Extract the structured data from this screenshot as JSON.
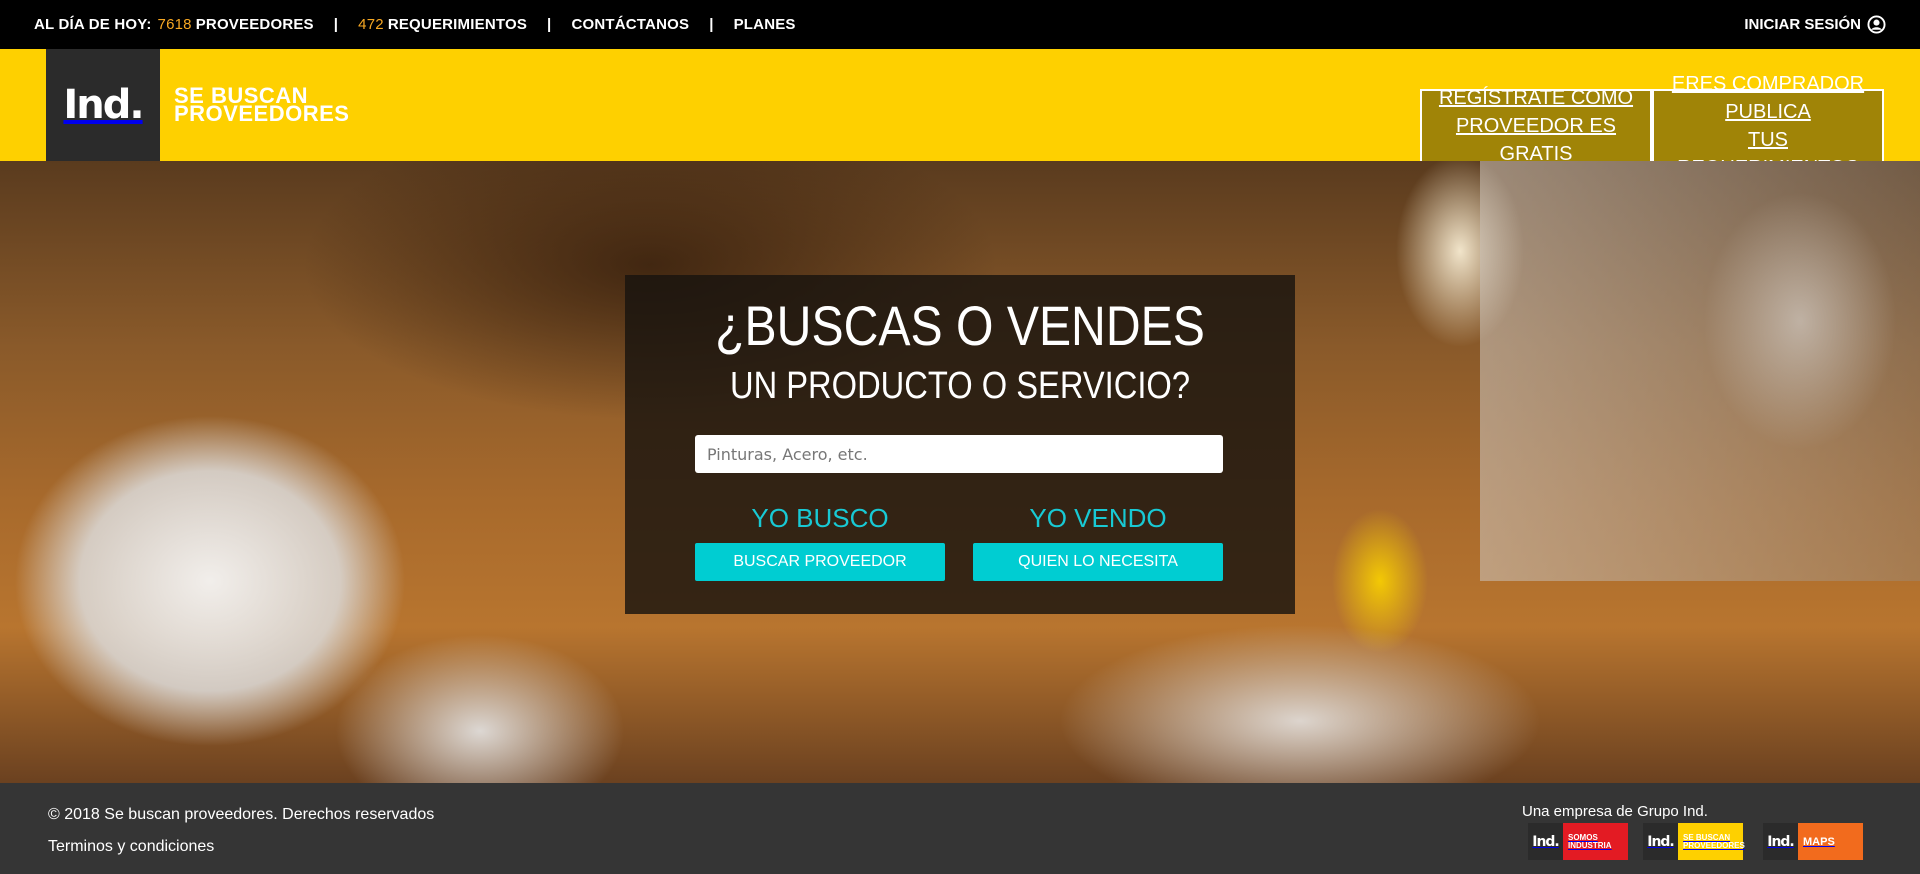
{
  "topbar": {
    "today_label": "AL DÍA DE HOY:",
    "providers_count": "7618",
    "providers_label": "PROVEEDORES",
    "sep1": "|",
    "requirements_count": "472",
    "requirements_label": "REQUERIMIENTOS",
    "sep2": "|",
    "contact_label": "CONTÁCTANOS",
    "sep3": "|",
    "plans_label": "PLANES",
    "login_label": "INICIAR SESIÓN",
    "login_icon": "user-circle-icon"
  },
  "header": {
    "logo_text": "Ind.",
    "brand_line1": "SE BUSCAN",
    "brand_line2": "PROVEEDORES",
    "register_btn_line1": "REGÍSTRATE COMO",
    "register_btn_line2": "PROVEEDOR ES GRATIS",
    "buyer_btn_line1": "ERES COMPRADOR PUBLICA",
    "buyer_btn_line2": "TUS REQUERIMIENTOS"
  },
  "search_panel": {
    "title": "¿BUSCAS O VENDES",
    "subtitle": "UN PRODUCTO O SERVICIO?",
    "search_placeholder": "Pinturas, Acero, etc.",
    "search_value": "",
    "buy_label": "YO BUSCO",
    "buy_button": "BUSCAR PROVEEDOR",
    "sell_label": "YO VENDO",
    "sell_button": "QUIEN LO NECESITA"
  },
  "footer": {
    "copyright": "© 2018 Se buscan proveedores. Derechos reservados",
    "terms": "Terminos y condiciones",
    "group_text": "Una empresa de Grupo Ind.",
    "logos": [
      {
        "mark": "Ind.",
        "line1": "SOMOS",
        "line2": "INDUSTRIA"
      },
      {
        "mark": "Ind.",
        "line1": "SE BUSCAN",
        "line2": "PROVEEDORES"
      },
      {
        "mark": "Ind.",
        "line1": "MAPS",
        "line2": ""
      }
    ]
  },
  "colors": {
    "accent_yellow": "#fed000",
    "header_button": "#a08407",
    "cyan": "#00cdd2",
    "counter_orange": "#f7a823",
    "red_logo": "#e31b23",
    "orange_logo": "#f26b1d"
  }
}
